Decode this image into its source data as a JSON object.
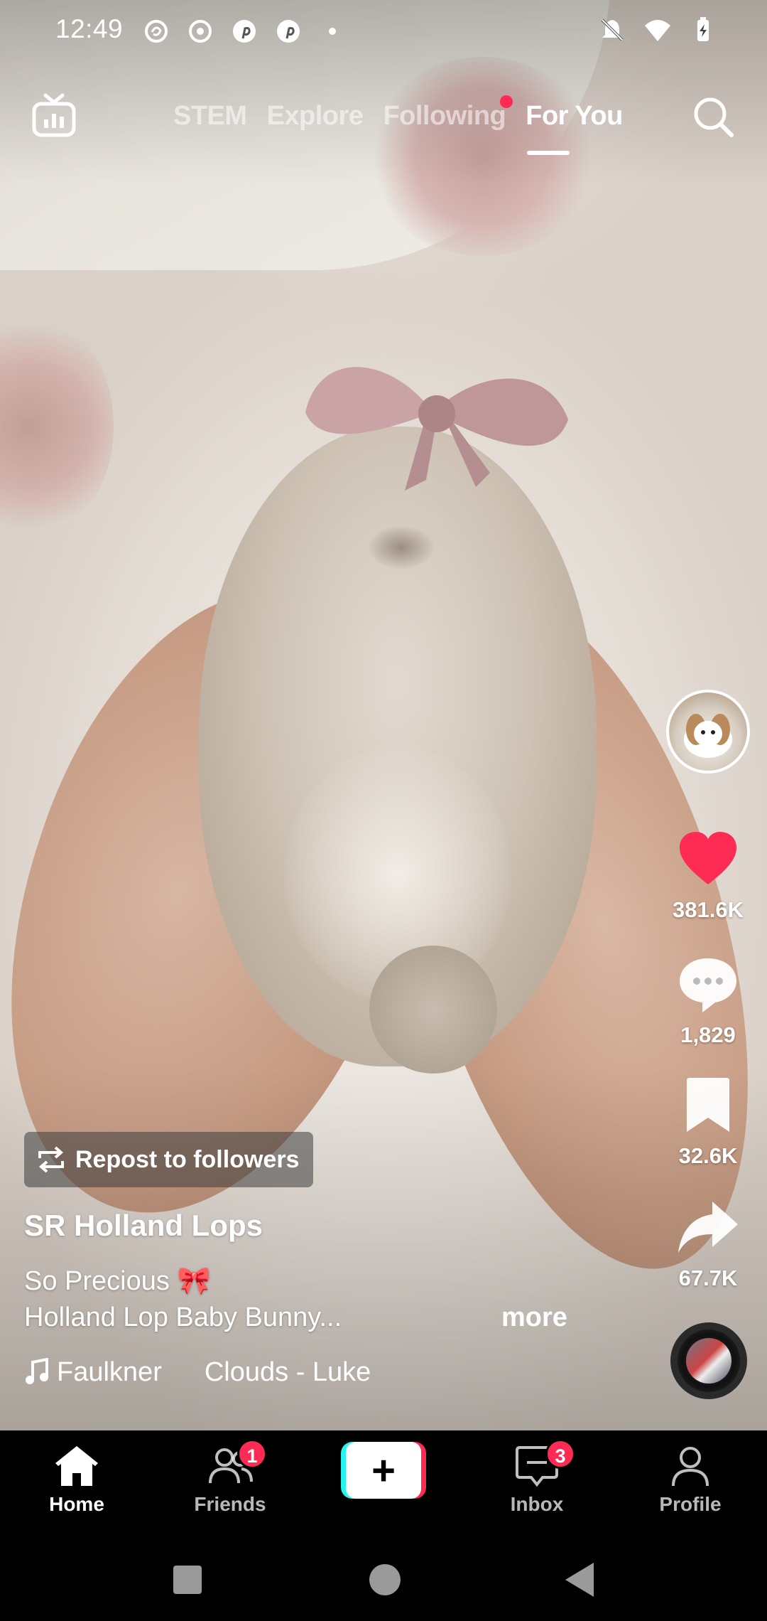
{
  "status_bar": {
    "time": "12:49",
    "left_icons": [
      "threads-icon",
      "record-icon",
      "pinterest-icon",
      "pinterest-icon",
      "dot-icon"
    ],
    "right_icons": [
      "mute-icon",
      "wifi-icon",
      "battery-charging-icon"
    ]
  },
  "top_nav": {
    "tabs": [
      {
        "label": "STEM",
        "active": false
      },
      {
        "label": "Explore",
        "active": false
      },
      {
        "label": "Following",
        "active": false,
        "has_dot": true
      },
      {
        "label": "For You",
        "active": true
      }
    ]
  },
  "video": {
    "repost_label": "Repost to followers",
    "author": "SR Holland Lops",
    "caption_line1": "So Precious 🎀",
    "caption_line2": "Holland Lop Baby Bunny...",
    "more_label": "more",
    "music_artist": "Faulkner",
    "music_title": "Clouds - Luke"
  },
  "right_rail": {
    "likes": "381.6K",
    "comments": "1,829",
    "saves": "32.6K",
    "shares": "67.7K"
  },
  "bottom_nav": {
    "items": [
      {
        "label": "Home",
        "icon": "home-icon",
        "active": true
      },
      {
        "label": "Friends",
        "icon": "friends-icon",
        "badge": "1"
      },
      {
        "label": "",
        "icon": "create-plus-icon"
      },
      {
        "label": "Inbox",
        "icon": "inbox-icon",
        "badge": "3"
      },
      {
        "label": "Profile",
        "icon": "profile-icon"
      }
    ]
  },
  "colors": {
    "accent": "#fe2c55",
    "cyan": "#25f4ee",
    "like_red": "#fe2c55"
  }
}
